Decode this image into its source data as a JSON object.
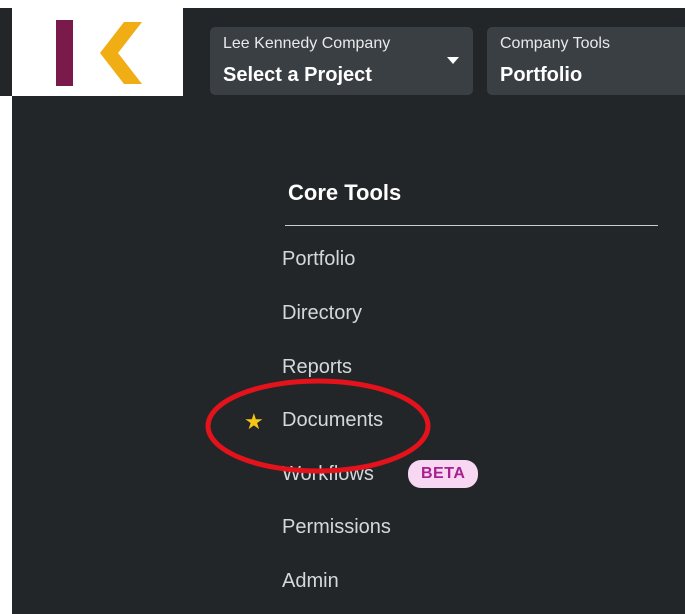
{
  "header": {
    "logo_icon": "company-logo",
    "project_selector": {
      "company": "Lee Kennedy Company",
      "value": "Select a Project",
      "caret_icon": "caret-down-icon"
    },
    "tools_selector": {
      "label": "Company Tools",
      "value": "Portfolio"
    }
  },
  "menu": {
    "heading": "Core Tools",
    "items": [
      {
        "label": "Portfolio"
      },
      {
        "label": "Directory"
      },
      {
        "label": "Reports"
      },
      {
        "label": "Documents",
        "favorite_icon": "star-icon"
      },
      {
        "label": "Workflows",
        "badge": "BETA"
      },
      {
        "label": "Permissions"
      },
      {
        "label": "Admin"
      }
    ]
  },
  "annotation": {
    "shape": "ellipse",
    "color": "#e4121b",
    "target": "Documents"
  },
  "colors": {
    "logo_bar": "#7a1a4a",
    "logo_chevron": "#f0ad14",
    "background": "#232628",
    "selector_bg": "#3a3f43",
    "star": "#f5c518",
    "badge_bg": "#f7d7f2",
    "badge_text": "#a8208f"
  }
}
